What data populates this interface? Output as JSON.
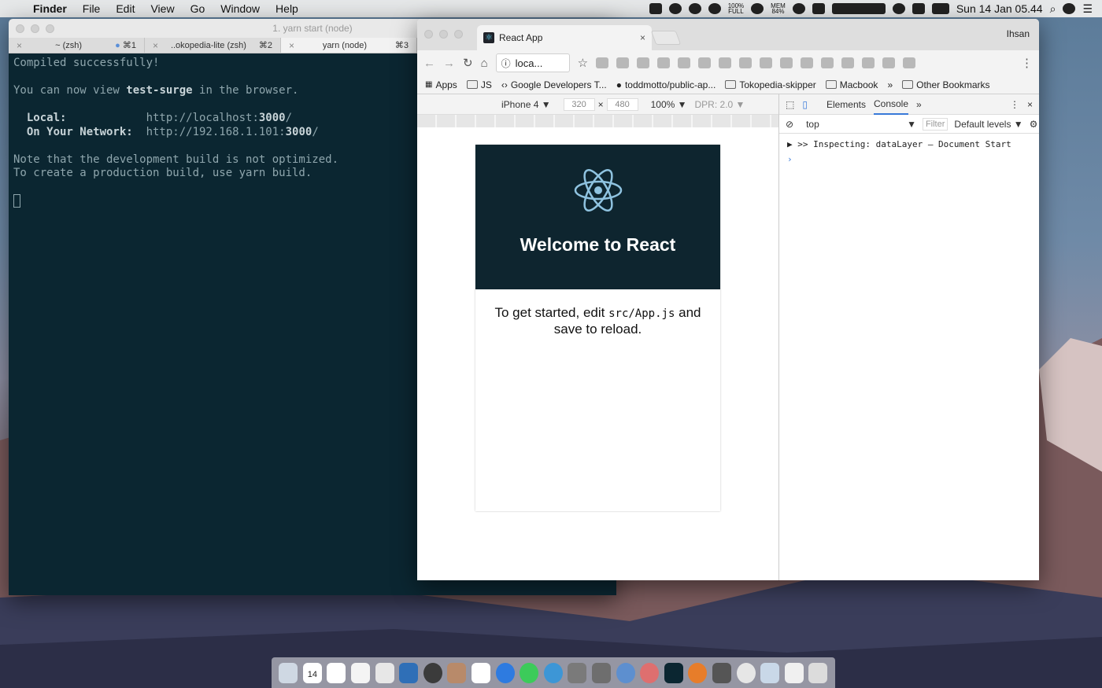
{
  "menubar": {
    "app_name": "Finder",
    "menus": [
      "File",
      "Edit",
      "View",
      "Go",
      "Window",
      "Help"
    ],
    "battery_small_top": "100%",
    "battery_small_bottom": "FULL",
    "mem_top": "MEM",
    "mem_bottom": "84%",
    "clock": "Sun 14 Jan  05.44"
  },
  "terminal": {
    "title": "1. yarn start (node)",
    "tabs": [
      {
        "label": "~ (zsh)",
        "shortcut": "⌘1"
      },
      {
        "label": "..okopedia-lite (zsh)",
        "shortcut": "⌘2"
      },
      {
        "label": "yarn (node)",
        "shortcut": "⌘3"
      }
    ],
    "line1": "Compiled successfully!",
    "line2_pre": "You can now view ",
    "line2_bold": "test-surge",
    "line2_post": " in the browser.",
    "local_label": "  Local:            ",
    "local_url_pre": "http://localhost:",
    "local_url_port": "3000",
    "local_url_post": "/",
    "network_label": "  On Your Network:  ",
    "network_url_pre": "http://192.168.1.101:",
    "network_url_port": "3000",
    "network_url_post": "/",
    "note1": "Note that the development build is not optimized.",
    "note2": "To create a production build, use yarn build."
  },
  "browser": {
    "tab_title": "React App",
    "profile": "Ihsan",
    "address": "loca...",
    "bookmarks": [
      "Apps",
      "JS",
      "Google Developers T...",
      "toddmotto/public-ap...",
      "Tokopedia-skipper",
      "Macbook"
    ],
    "bookmarks_more": "»",
    "other_bookmarks": "Other Bookmarks",
    "device": "iPhone 4 ▼",
    "width": "320",
    "height": "480",
    "times": "×",
    "zoom": "100% ▼",
    "dpr": "DPR: 2.0 ▼"
  },
  "app": {
    "title": "Welcome to React",
    "intro_pre": "To get started, edit ",
    "intro_code": "src/App.js",
    "intro_post": " and save to reload."
  },
  "devtools": {
    "tabs": [
      "Elements",
      "Console"
    ],
    "more": "»",
    "context": "top",
    "filter_placeholder": "Filter",
    "levels": "Default levels ▼",
    "log": ">> Inspecting: dataLayer  – Document Start",
    "prompt": "›"
  },
  "dock": {
    "calendar_day": "14"
  }
}
